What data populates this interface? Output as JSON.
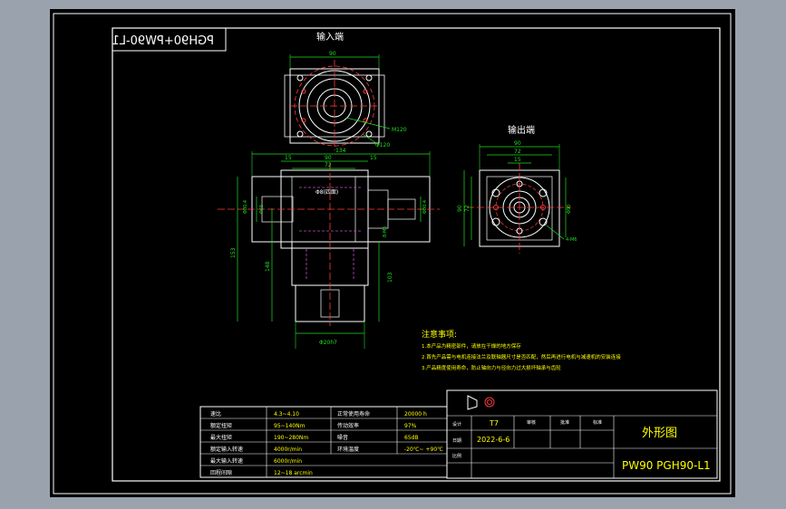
{
  "drawing": {
    "mirrored_code": "PGH90+PW90-L1",
    "input_end_label": "输入端",
    "output_end_label": "输出端",
    "colors": {
      "background": "#9aa3ad",
      "sheet": "#000000",
      "frame": "#ffffff",
      "part": "#ffffff",
      "center_line": "#ff3b3b",
      "dimension": "#22dd22",
      "note": "#ffff00",
      "hidden": "#c050c0"
    },
    "input_dims": {
      "top": "90",
      "bolt_circle": "M120",
      "outer": "Φ120"
    },
    "side_dims": {
      "total": "134",
      "width_1": "15",
      "width_2": "90",
      "width_3": "72",
      "width_4": "15",
      "bore": "Φ8(四面)",
      "left_1": "Φ80.4",
      "left_2": "Φ65",
      "right_1": "Φ80.4",
      "pcd": "8-M6",
      "vertical_1": "153",
      "vertical_2": "148",
      "vertical_3": "103",
      "shaft": "Φ20h7"
    },
    "output_dims": {
      "top_1": "90",
      "top_2": "72",
      "top_3": "15",
      "left_1": "90",
      "left_2": "72",
      "right_1": "Φ90",
      "holes": "4-M6"
    },
    "notes": {
      "title": "注意事项:",
      "lines": [
        "1.本产品为精密部件，请放在干燥的地方保存",
        "2.首先产品需与电机连接法兰及联轴器尺寸是否匹配，然后再进行电机与减速机的安装连接",
        "3.产品精度使用寿命，防止轴向力与径向力过大损坏轴承与齿轮"
      ]
    },
    "specs": {
      "rows": [
        [
          "速比",
          "4.3~4.10",
          "正常使用寿命",
          "20000 h"
        ],
        [
          "额定扭矩",
          "95~140Nm",
          "传动效率",
          "97%"
        ],
        [
          "最大扭矩",
          "190~280Nm",
          "噪音",
          "65dB"
        ],
        [
          "额定输入转速",
          "4000r/min",
          "环境温度",
          "-20℃~ +90℃"
        ],
        [
          "最大输入转速",
          "6000r/min",
          "",
          ""
        ],
        [
          "回程间隙",
          "12~18 arcmin",
          "",
          ""
        ]
      ]
    },
    "title_block": {
      "sheet_title": "外形图",
      "model": "PW90 PGH90-L1",
      "designer": "T7",
      "date": "2022-6-6",
      "header_1": "审核",
      "header_2": "批准",
      "header_3": "标准",
      "row_label_1": "设计",
      "row_label_2": "日期",
      "row_label_3": "比例"
    }
  }
}
